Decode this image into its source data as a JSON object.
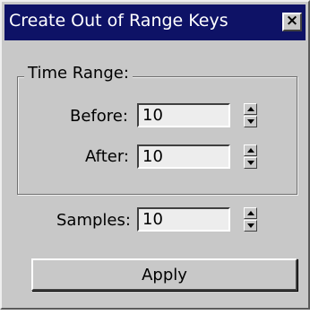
{
  "dialog": {
    "title": "Create Out of Range Keys",
    "close_glyph": "×"
  },
  "time_range": {
    "label": "Time Range:",
    "before_label": "Before:",
    "before_value": "10",
    "after_label": "After:",
    "after_value": "10"
  },
  "samples": {
    "label": "Samples:",
    "value": "10"
  },
  "apply_label": "Apply"
}
